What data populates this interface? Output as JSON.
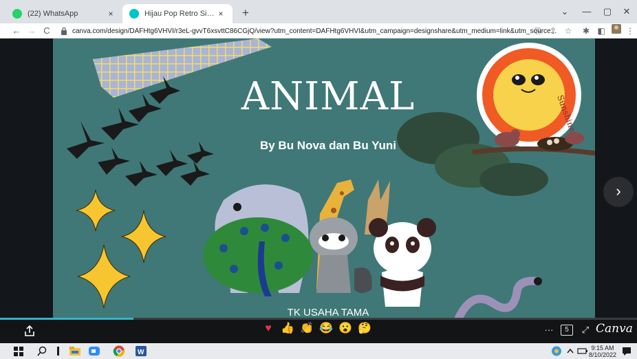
{
  "tabs": [
    {
      "title": "(22) WhatsApp",
      "close": "×",
      "favicon_color": "#25d366"
    },
    {
      "title": "Hijau Pop Retro Simpel Ilustrasi P",
      "close": "×",
      "favicon_color": "#00c4cc"
    }
  ],
  "new_tab": "+",
  "window": {
    "minimize": "—",
    "restore": "▢",
    "close": "✕",
    "tab_search": "⌄"
  },
  "nav": {
    "back": "←",
    "forward": "→",
    "reload": "C"
  },
  "address": {
    "url": "canva.com/design/DAFHtg6VHVI/r3eL-gvvT6xsvttC86CGjQ/view?utm_content=DAFHtg6VHVI&utm_campaign=designshare&utm_medium=link&utm_source..."
  },
  "slide": {
    "title": "ANIMAL",
    "subtitle": "By Bu Nova dan Bu Yuni",
    "footer": "TK USAHA TAMA",
    "sun_text": "Sunshine"
  },
  "player": {
    "next": "›",
    "more": "···",
    "page_count": "5",
    "fullscreen": "⤢",
    "brand": "Canva",
    "progress": 0.21,
    "reactions": [
      "♥",
      "👍",
      "👏",
      "😂",
      "😮",
      "🤔"
    ]
  },
  "taskbar": {
    "time": "9:15 AM",
    "date": "8/10/2022"
  },
  "colors": {
    "slide_bg": "#3f7877",
    "accent": "#35b4c8",
    "sun": "#f7c942",
    "sun_ring": "#f05a24"
  }
}
